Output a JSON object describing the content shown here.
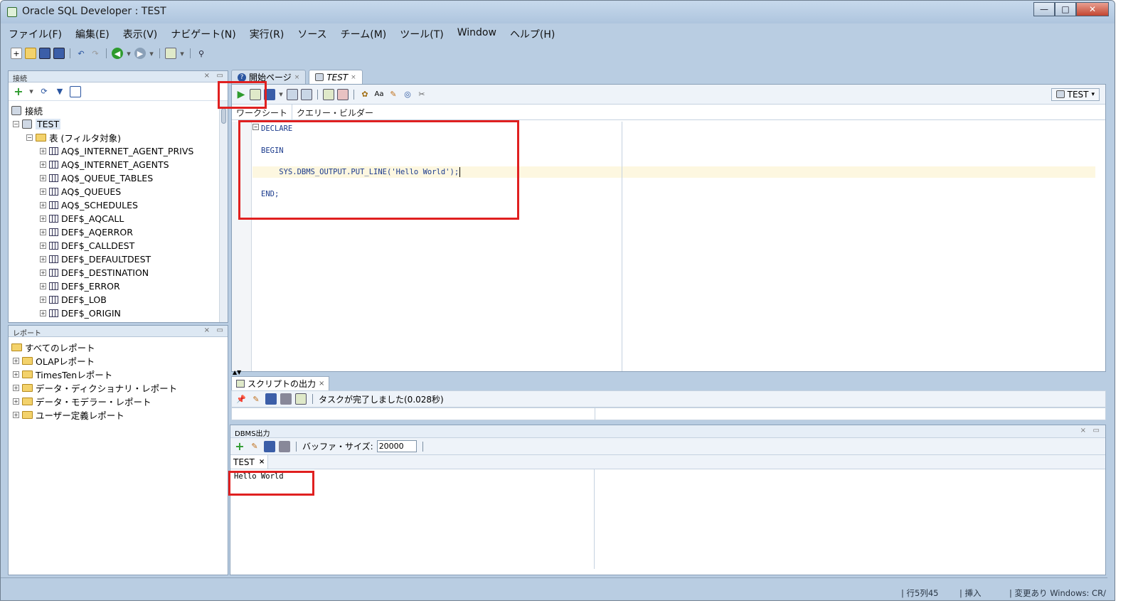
{
  "window": {
    "title": "Oracle SQL Developer : TEST",
    "buttons": {
      "minimize": "—",
      "maximize": "□",
      "close": "✕"
    }
  },
  "menu": [
    "ファイル(F)",
    "編集(E)",
    "表示(V)",
    "ナビゲート(N)",
    "実行(R)",
    "ソース",
    "チーム(M)",
    "ツール(T)",
    "Window",
    "ヘルプ(H)"
  ],
  "connections_panel": {
    "title": "接続",
    "root": "接続",
    "connection": "TEST",
    "tables_node": "表 (フィルタ対象)",
    "tables": [
      "AQ$_INTERNET_AGENT_PRIVS",
      "AQ$_INTERNET_AGENTS",
      "AQ$_QUEUE_TABLES",
      "AQ$_QUEUES",
      "AQ$_SCHEDULES",
      "DEF$_AQCALL",
      "DEF$_AQERROR",
      "DEF$_CALLDEST",
      "DEF$_DEFAULTDEST",
      "DEF$_DESTINATION",
      "DEF$_ERROR",
      "DEF$_LOB",
      "DEF$_ORIGIN"
    ]
  },
  "reports_panel": {
    "title": "レポート",
    "root": "すべてのレポート",
    "items": [
      "OLAPレポート",
      "TimesTenレポート",
      "データ・ディクショナリ・レポート",
      "データ・モデラー・レポート",
      "ユーザー定義レポート"
    ]
  },
  "doc_tabs": [
    {
      "label": "開始ページ"
    },
    {
      "label": "TEST"
    }
  ],
  "editor": {
    "connection_selector": "TEST",
    "subtabs": [
      "ワークシート",
      "クエリー・ビルダー"
    ],
    "code_lines": [
      "DECLARE",
      "BEGIN",
      "    SYS.DBMS_OUTPUT.PUT_LINE('Hello World');",
      "END;"
    ]
  },
  "script_output": {
    "tab_label": "スクリプトの出力",
    "status": "タスクが完了しました(0.028秒)"
  },
  "dbms_output": {
    "title": "DBMS出力",
    "buffer_label": "バッファ・サイズ:",
    "buffer_value": "20000",
    "tab_label": "TEST",
    "output": "Hello World"
  },
  "statusbar": {
    "position": "行5列45",
    "mode": "挿入",
    "modified": "変更あり",
    "line_ending": "Windows: CR/"
  },
  "colors": {
    "chrome": "#b9cde2",
    "highlight_box": "#e02020",
    "run_green": "#2e9b2e"
  }
}
